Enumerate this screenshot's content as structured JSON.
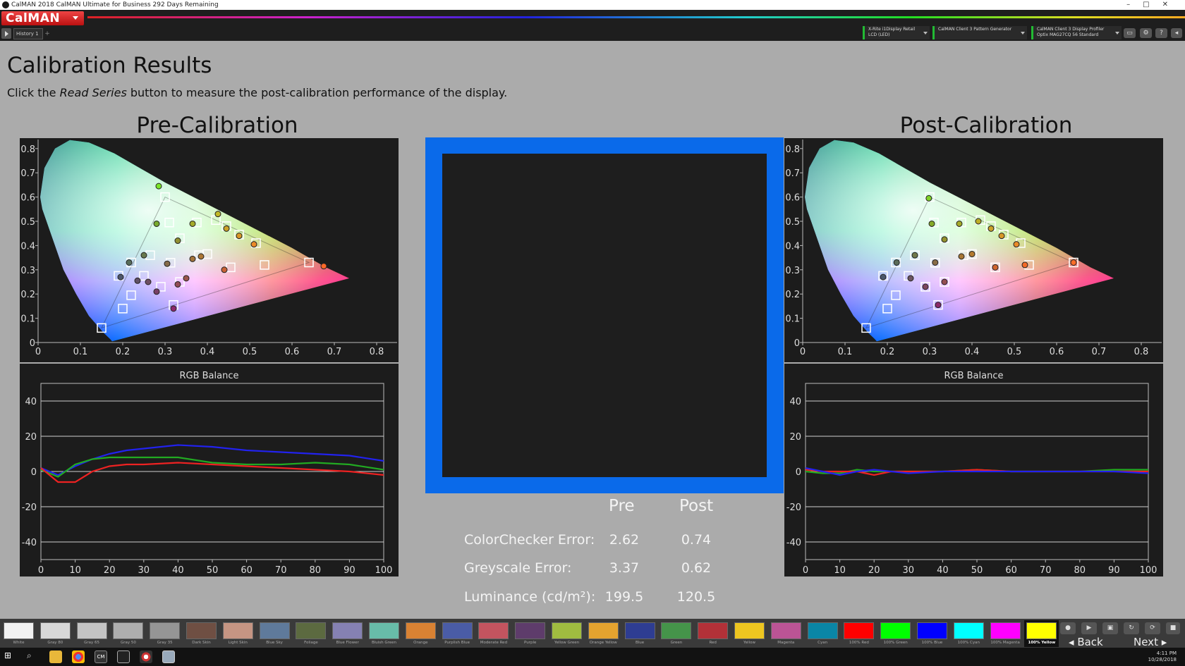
{
  "window": {
    "title": "CalMAN 2018 CalMAN Ultimate for Business 292 Days Remaining"
  },
  "app": {
    "logo": "CalMAN"
  },
  "history": {
    "tab_label": "History 1"
  },
  "devices": [
    {
      "line1": "X-Rite i1Display Retail",
      "line2": "LCD (LED)"
    },
    {
      "line1": "CalMAN Client 3 Pattern Generator",
      "line2": ""
    },
    {
      "line1": "CalMAN Client 3 Display Profiler",
      "line2": "Optix MAG27CQ 56 Standard"
    }
  ],
  "header": {
    "title": "Calibration Results",
    "subtitle_pre": "Click the ",
    "subtitle_em": "Read Series",
    "subtitle_post": " button to measure the post-calibration performance of the display."
  },
  "pre": {
    "title": "Pre-Calibration"
  },
  "post": {
    "title": "Post-Calibration"
  },
  "results": {
    "col_pre": "Pre",
    "col_post": "Post",
    "rows": [
      {
        "label": "ColorChecker Error:",
        "pre": "2.62",
        "post": "0.74"
      },
      {
        "label": "Greyscale Error:",
        "pre": "3.37",
        "post": "0.62"
      },
      {
        "label": "Luminance (cd/m²):",
        "pre": "199.5",
        "post": "120.5"
      }
    ]
  },
  "chart_data": [
    {
      "type": "scatter",
      "name": "pre-cie",
      "xlim": [
        0,
        0.85
      ],
      "ylim": [
        0,
        0.85
      ],
      "x_ticks": [
        0,
        0.1,
        0.2,
        0.3,
        0.4,
        0.5,
        0.6,
        0.7,
        0.8
      ],
      "y_ticks": [
        0,
        0.1,
        0.2,
        0.3,
        0.4,
        0.5,
        0.6,
        0.7,
        0.8
      ],
      "tick_labels": [
        "0",
        "0.1",
        "0.2",
        "0.3",
        "0.4",
        "0.5",
        "0.6",
        "0.7",
        "0.8"
      ],
      "targets": [
        [
          0.3,
          0.6
        ],
        [
          0.64,
          0.33
        ],
        [
          0.15,
          0.06
        ],
        [
          0.313,
          0.329
        ],
        [
          0.22,
          0.33
        ],
        [
          0.32,
          0.155
        ],
        [
          0.42,
          0.505
        ],
        [
          0.2,
          0.14
        ],
        [
          0.22,
          0.195
        ],
        [
          0.19,
          0.275
        ],
        [
          0.25,
          0.275
        ],
        [
          0.29,
          0.23
        ],
        [
          0.335,
          0.25
        ],
        [
          0.455,
          0.31
        ],
        [
          0.535,
          0.32
        ],
        [
          0.265,
          0.36
        ],
        [
          0.335,
          0.43
        ],
        [
          0.375,
          0.495
        ],
        [
          0.31,
          0.495
        ],
        [
          0.4,
          0.365
        ],
        [
          0.445,
          0.48
        ],
        [
          0.475,
          0.445
        ],
        [
          0.515,
          0.41
        ],
        [
          0.38,
          0.36
        ]
      ],
      "measured": [
        [
          0.285,
          0.645
        ],
        [
          0.675,
          0.315
        ],
        [
          0.32,
          0.14
        ],
        [
          0.305,
          0.325
        ],
        [
          0.215,
          0.33
        ],
        [
          0.425,
          0.53
        ],
        [
          0.195,
          0.27
        ],
        [
          0.28,
          0.21
        ],
        [
          0.26,
          0.25
        ],
        [
          0.35,
          0.265
        ],
        [
          0.44,
          0.3
        ],
        [
          0.33,
          0.24
        ],
        [
          0.25,
          0.36
        ],
        [
          0.33,
          0.42
        ],
        [
          0.28,
          0.49
        ],
        [
          0.365,
          0.49
        ],
        [
          0.385,
          0.355
        ],
        [
          0.445,
          0.47
        ],
        [
          0.475,
          0.44
        ],
        [
          0.51,
          0.405
        ],
        [
          0.365,
          0.345
        ],
        [
          0.235,
          0.255
        ]
      ]
    },
    {
      "type": "scatter",
      "name": "post-cie",
      "xlim": [
        0,
        0.85
      ],
      "ylim": [
        0,
        0.85
      ],
      "x_ticks": [
        0,
        0.1,
        0.2,
        0.3,
        0.4,
        0.5,
        0.6,
        0.7,
        0.8
      ],
      "y_ticks": [
        0,
        0.1,
        0.2,
        0.3,
        0.4,
        0.5,
        0.6,
        0.7,
        0.8
      ],
      "tick_labels": [
        "0",
        "0.1",
        "0.2",
        "0.3",
        "0.4",
        "0.5",
        "0.6",
        "0.7",
        "0.8"
      ],
      "targets": [
        [
          0.3,
          0.6
        ],
        [
          0.64,
          0.33
        ],
        [
          0.15,
          0.06
        ],
        [
          0.313,
          0.329
        ],
        [
          0.22,
          0.33
        ],
        [
          0.32,
          0.155
        ],
        [
          0.42,
          0.505
        ],
        [
          0.2,
          0.14
        ],
        [
          0.22,
          0.195
        ],
        [
          0.19,
          0.275
        ],
        [
          0.25,
          0.275
        ],
        [
          0.29,
          0.23
        ],
        [
          0.335,
          0.25
        ],
        [
          0.455,
          0.31
        ],
        [
          0.535,
          0.32
        ],
        [
          0.265,
          0.36
        ],
        [
          0.335,
          0.43
        ],
        [
          0.375,
          0.495
        ],
        [
          0.31,
          0.495
        ],
        [
          0.4,
          0.365
        ],
        [
          0.445,
          0.48
        ],
        [
          0.475,
          0.445
        ],
        [
          0.515,
          0.41
        ],
        [
          0.38,
          0.36
        ]
      ],
      "measured": [
        [
          0.298,
          0.595
        ],
        [
          0.64,
          0.33
        ],
        [
          0.32,
          0.155
        ],
        [
          0.313,
          0.33
        ],
        [
          0.222,
          0.33
        ],
        [
          0.415,
          0.5
        ],
        [
          0.19,
          0.27
        ],
        [
          0.29,
          0.23
        ],
        [
          0.265,
          0.36
        ],
        [
          0.335,
          0.425
        ],
        [
          0.305,
          0.49
        ],
        [
          0.37,
          0.49
        ],
        [
          0.4,
          0.365
        ],
        [
          0.445,
          0.47
        ],
        [
          0.47,
          0.44
        ],
        [
          0.505,
          0.405
        ],
        [
          0.375,
          0.355
        ],
        [
          0.455,
          0.31
        ],
        [
          0.525,
          0.32
        ],
        [
          0.335,
          0.25
        ],
        [
          0.255,
          0.265
        ]
      ]
    },
    {
      "type": "line",
      "name": "pre-rgb-balance",
      "title": "RGB Balance",
      "x": [
        0,
        5,
        10,
        15,
        20,
        25,
        30,
        40,
        50,
        60,
        70,
        80,
        90,
        100
      ],
      "xlim": [
        0,
        100
      ],
      "ylim": [
        -50,
        50
      ],
      "x_ticks": [
        0,
        10,
        20,
        30,
        40,
        50,
        60,
        70,
        80,
        90,
        100
      ],
      "y_ticks": [
        -40,
        -20,
        0,
        20,
        40
      ],
      "series": [
        {
          "color": "#2222ee",
          "values": [
            2,
            -2,
            3,
            7,
            10,
            12,
            13,
            15,
            14,
            12,
            11,
            10,
            9,
            6
          ]
        },
        {
          "color": "#22aa22",
          "values": [
            1,
            -3,
            4,
            7,
            8,
            8,
            8,
            8,
            5,
            4,
            4,
            5,
            4,
            1
          ]
        },
        {
          "color": "#ee2222",
          "values": [
            2,
            -6,
            -6,
            0,
            3,
            4,
            4,
            5,
            4,
            3,
            2,
            1,
            0,
            -2
          ]
        }
      ]
    },
    {
      "type": "line",
      "name": "post-rgb-balance",
      "title": "RGB Balance",
      "x": [
        0,
        5,
        10,
        15,
        20,
        25,
        30,
        40,
        50,
        60,
        70,
        80,
        90,
        100
      ],
      "xlim": [
        0,
        100
      ],
      "ylim": [
        -50,
        50
      ],
      "x_ticks": [
        0,
        10,
        20,
        30,
        40,
        50,
        60,
        70,
        80,
        90,
        100
      ],
      "y_ticks": [
        -40,
        -20,
        0,
        20,
        40
      ],
      "series": [
        {
          "color": "#22aa22",
          "values": [
            0,
            -1,
            -1,
            1,
            0,
            0,
            0,
            0,
            1,
            0,
            0,
            0,
            1,
            1
          ]
        },
        {
          "color": "#ee2222",
          "values": [
            1,
            0,
            0,
            0,
            -2,
            0,
            0,
            0,
            1,
            0,
            0,
            0,
            0,
            0
          ]
        },
        {
          "color": "#2222ee",
          "values": [
            2,
            0,
            -2,
            0,
            1,
            0,
            -1,
            0,
            0,
            0,
            0,
            0,
            0,
            -1
          ]
        }
      ]
    }
  ],
  "swatches": [
    {
      "label": "White",
      "color": "#f2f2f2"
    },
    {
      "label": "Gray 80",
      "color": "#d8d8d8"
    },
    {
      "label": "Gray 65",
      "color": "#c4c4c4"
    },
    {
      "label": "Gray 50",
      "color": "#aeaeae"
    },
    {
      "label": "Gray 35",
      "color": "#959595"
    },
    {
      "label": "Dark Skin",
      "color": "#6f4f43"
    },
    {
      "label": "Light Skin",
      "color": "#c59583"
    },
    {
      "label": "Blue Sky",
      "color": "#5f7a9b"
    },
    {
      "label": "Foliage",
      "color": "#5c6a40"
    },
    {
      "label": "Blue Flower",
      "color": "#8581b2"
    },
    {
      "label": "Bluish Green",
      "color": "#68bca9"
    },
    {
      "label": "Orange",
      "color": "#d98233"
    },
    {
      "label": "Purplish Blue",
      "color": "#4a5ca6"
    },
    {
      "label": "Moderate Red",
      "color": "#c3545f"
    },
    {
      "label": "Purple",
      "color": "#5e3c6b"
    },
    {
      "label": "Yellow Green",
      "color": "#a0bc40"
    },
    {
      "label": "Orange Yellow",
      "color": "#e4a32f"
    },
    {
      "label": "Blue",
      "color": "#2e3d92"
    },
    {
      "label": "Green",
      "color": "#45944a"
    },
    {
      "label": "Red",
      "color": "#b23138"
    },
    {
      "label": "Yellow",
      "color": "#eec620"
    },
    {
      "label": "Magenta",
      "color": "#bb5495"
    },
    {
      "label": "Cyan",
      "color": "#0a86a6"
    },
    {
      "label": "100% Red",
      "color": "#ff0000"
    },
    {
      "label": "100% Green",
      "color": "#00ff00"
    },
    {
      "label": "100% Blue",
      "color": "#0000ff"
    },
    {
      "label": "100% Cyan",
      "color": "#00ffff"
    },
    {
      "label": "100% Magenta",
      "color": "#ff00ff"
    },
    {
      "label": "100% Yellow",
      "color": "#ffff00"
    }
  ],
  "nav": {
    "back": "Back",
    "next": "Next"
  },
  "taskbar": {
    "time": "4:11 PM",
    "date": "10/28/2018"
  },
  "colors": {
    "accent_blue": "#0a6aea",
    "panel_bg": "#1c1c1c",
    "page_bg": "#ababab"
  }
}
